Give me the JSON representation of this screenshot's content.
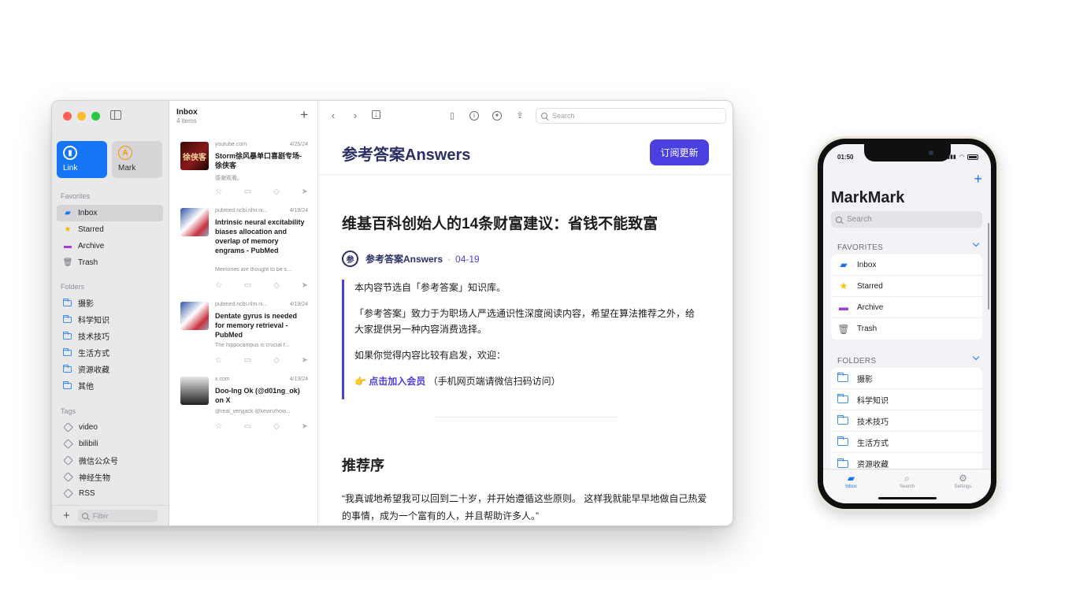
{
  "mac": {
    "sidebar": {
      "tiles": [
        {
          "label": "Link"
        },
        {
          "label": "Mark"
        }
      ],
      "favorites_title": "Favorites",
      "favorites": [
        {
          "label": "Inbox",
          "icon": "inbox-icon"
        },
        {
          "label": "Starred",
          "icon": "star-icon"
        },
        {
          "label": "Archive",
          "icon": "archive-icon"
        },
        {
          "label": "Trash",
          "icon": "trash-icon"
        }
      ],
      "folders_title": "Folders",
      "folders": [
        "摄影",
        "科学知识",
        "技术技巧",
        "生活方式",
        "资源收藏",
        "其他"
      ],
      "tags_title": "Tags",
      "tags": [
        "video",
        "bilibili",
        "微信公众号",
        "神经生物",
        "RSS"
      ],
      "filter_placeholder": "Filter"
    },
    "list": {
      "title": "Inbox",
      "count": "4 items",
      "items": [
        {
          "source": "youtube.com",
          "date": "4/25/24",
          "title": "Storm徐风暴单口喜剧专场-徐侠客",
          "snippet": "感谢观看。",
          "thumb_text": "徐侠客"
        },
        {
          "source": "pubmed.ncbi.nlm.ni...",
          "date": "4/19/24",
          "title": "Intrinsic neural excitability biases allocation and overlap of memory engrams - PubMed",
          "snippet": "Memories are thought to be s..."
        },
        {
          "source": "pubmed.ncbi.nlm.ni...",
          "date": "4/19/24",
          "title": "Dentate gyrus is needed for memory retrieval - PubMed",
          "snippet": "The hippocampus is crucial f..."
        },
        {
          "source": "x.com",
          "date": "4/13/24",
          "title": "Doo-Ing Ok (@d01ng_ok) on X",
          "snippet": "@real_veryjack @kevinzhow..."
        }
      ]
    },
    "reader": {
      "search_placeholder": "Search",
      "brand": "参考答案Answers",
      "subscribe_label": "订阅更新",
      "article_title": "维基百科创始人的14条财富建议：省钱不能致富",
      "avatar_text": "参",
      "author": "参考答案Answers",
      "dot": "·",
      "date": "04-19",
      "quote": {
        "p1": "本内容节选自「参考答案」知识库。",
        "p2": "「参考答案」致力于为职场人严选通识性深度阅读内容，希望在算法推荐之外，给大家提供另一种内容消费选择。",
        "p3": "如果你觉得内容比较有启发，欢迎：",
        "emoji": "👉",
        "link": "点击加入会员",
        "link_note": "（手机网页端请微信扫码访问）"
      },
      "section_title": "推荐序",
      "paragraph": "“我真诚地希望我可以回到二十岁，并开始遵循这些原则。 这样我就能早早地做自己热爱的事情，成为一个富有的人，并且帮助许多人。”"
    }
  },
  "phone": {
    "time": "01:50",
    "title": "MarkMark",
    "search_placeholder": "Search",
    "favorites_title": "FAVORITES",
    "favorites": [
      {
        "label": "Inbox",
        "icon": "inbox-icon"
      },
      {
        "label": "Starred",
        "icon": "star-icon"
      },
      {
        "label": "Archive",
        "icon": "archive-icon"
      },
      {
        "label": "Trash",
        "icon": "trash-icon"
      }
    ],
    "folders_title": "FOLDERS",
    "folders": [
      "摄影",
      "科学知识",
      "技术技巧",
      "生活方式",
      "资源收藏"
    ],
    "tabs": [
      {
        "label": "Inbox",
        "icon": "inbox-icon"
      },
      {
        "label": "Search",
        "icon": "search-icon"
      },
      {
        "label": "Settings",
        "icon": "gear-icon"
      }
    ]
  },
  "colors": {
    "accent": "#1476f5",
    "brand": "#4b3fe0",
    "brand_text": "#2b2f66"
  }
}
